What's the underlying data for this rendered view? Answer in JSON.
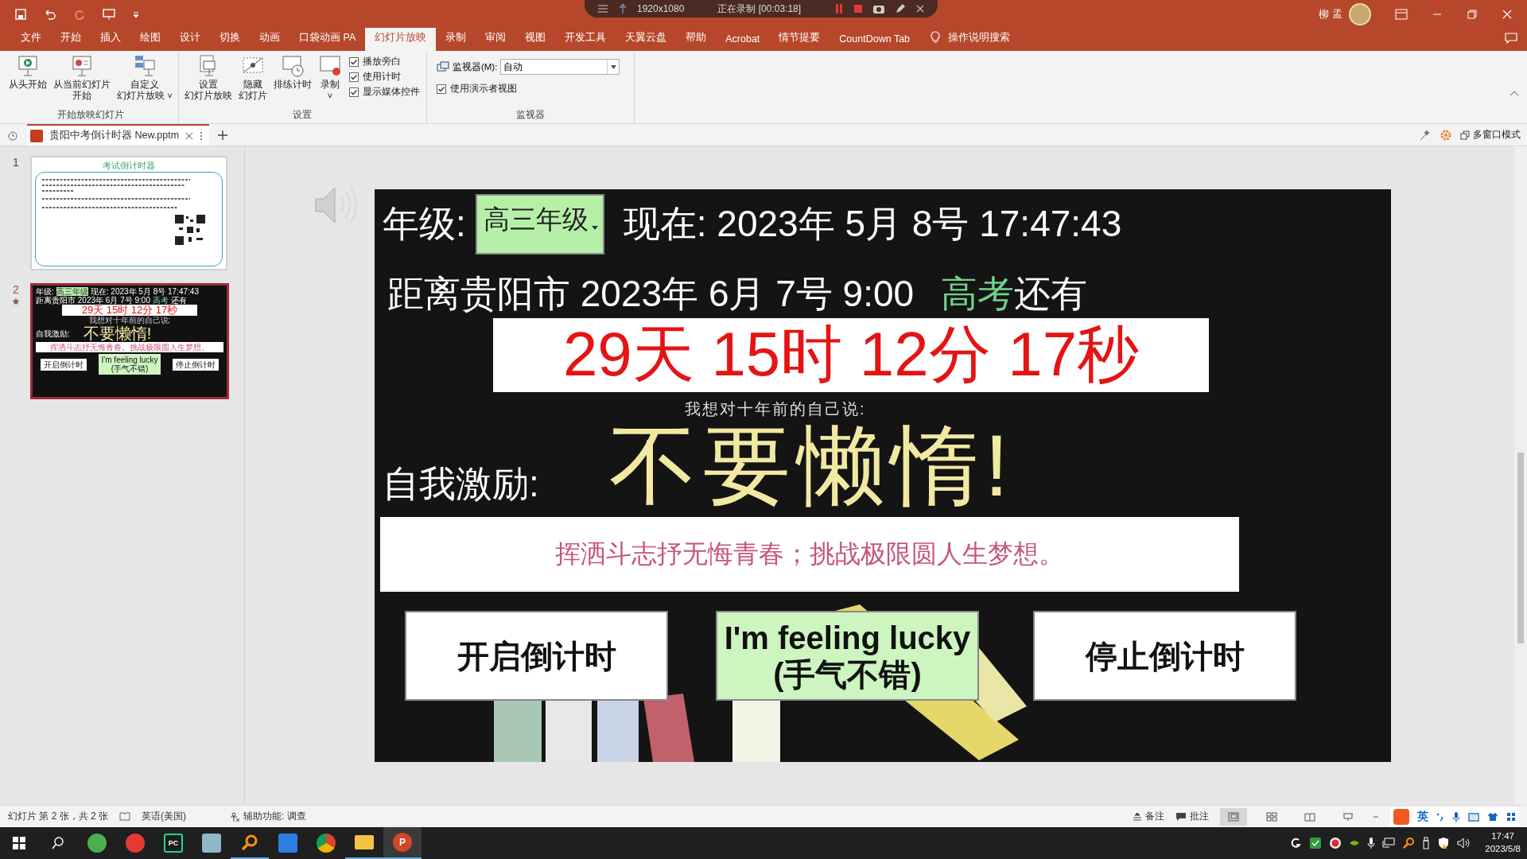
{
  "title_bar": {
    "recorder": {
      "resolution": "1920x1080",
      "status": "正在录制 [00:03:18]"
    },
    "user": "柳 孟"
  },
  "menu_tabs": [
    {
      "label": "文件",
      "selected": false
    },
    {
      "label": "开始",
      "selected": false
    },
    {
      "label": "插入",
      "selected": false
    },
    {
      "label": "绘图",
      "selected": false
    },
    {
      "label": "设计",
      "selected": false
    },
    {
      "label": "切换",
      "selected": false
    },
    {
      "label": "动画",
      "selected": false
    },
    {
      "label": "口袋动画 PA",
      "selected": false
    },
    {
      "label": "幻灯片放映",
      "selected": true
    },
    {
      "label": "录制",
      "selected": false
    },
    {
      "label": "审阅",
      "selected": false
    },
    {
      "label": "视图",
      "selected": false
    },
    {
      "label": "开发工具",
      "selected": false
    },
    {
      "label": "天翼云盘",
      "selected": false
    },
    {
      "label": "帮助",
      "selected": false
    },
    {
      "label": "Acrobat",
      "selected": false
    },
    {
      "label": "情节提要",
      "selected": false
    },
    {
      "label": "CountDown Tab",
      "selected": false
    }
  ],
  "tell_me": "操作说明搜索",
  "ribbon": {
    "groups": [
      {
        "label": "开始放映幻灯片",
        "items": [
          {
            "kind": "button",
            "lines": [
              "从头开始"
            ]
          },
          {
            "kind": "button",
            "lines": [
              "从当前幻灯片",
              "开始"
            ]
          },
          {
            "kind": "button",
            "lines": [
              "自定义",
              "幻灯片放映 ˅"
            ]
          }
        ]
      },
      {
        "label": "设置",
        "items": [
          {
            "kind": "button",
            "lines": [
              "设置",
              "幻灯片放映"
            ]
          },
          {
            "kind": "button",
            "lines": [
              "隐藏",
              "幻灯片"
            ]
          },
          {
            "kind": "button",
            "lines": [
              "排练计时"
            ]
          },
          {
            "kind": "button",
            "lines": [
              "录制",
              "˅"
            ]
          },
          {
            "kind": "checks",
            "checks": [
              {
                "label": "播放旁白",
                "checked": true
              },
              {
                "label": "使用计时",
                "checked": true
              },
              {
                "label": "显示媒体控件",
                "checked": true
              }
            ]
          }
        ]
      },
      {
        "label": "监视器",
        "items": [
          {
            "kind": "monitor",
            "label": "监视器(M):",
            "value": "自动",
            "checks": [
              {
                "label": "使用演示者视图",
                "checked": true
              }
            ]
          }
        ]
      }
    ]
  },
  "doc_tab": {
    "name": "贵阳中考倒计时器 New.pptm"
  },
  "multi_window": "多窗口模式",
  "thumbnails": [
    {
      "number": "1",
      "selected": false,
      "kind": "info",
      "title": "考试倒计时器"
    },
    {
      "number": "2",
      "selected": true,
      "kind": "countdown",
      "grade_label": "年级:",
      "grade": "高三年级",
      "now": "现在: 2023年 5月 8号 17:47:43",
      "target": "距离贵阳市 2023年 6月 7号 9:00",
      "exam": "高考",
      "remaining": "还有",
      "countdown": "29天 15时 12分 17秒",
      "note": "我想对十年前的自己说:",
      "motivation_label": "自我激励:",
      "motivation": "不要懒惰!",
      "motto": "挥洒斗志抒无悔青春。挑战极限圆人生梦想。",
      "buttons": [
        {
          "lines": [
            "开启倒计时"
          ],
          "selected": false
        },
        {
          "lines": [
            "I'm feeling lucky",
            "(手气不错)"
          ],
          "selected": true
        },
        {
          "lines": [
            "停止倒计时"
          ],
          "selected": false
        }
      ]
    }
  ],
  "slide": {
    "grade_label": "年级:",
    "grade": "高三年级",
    "now": "现在: 2023年 5月 8号 17:47:43",
    "target": "距离贵阳市 2023年 6月 7号 9:00",
    "exam": "高考",
    "remaining": "还有",
    "countdown": "29天 15时 12分 17秒",
    "note": "我想对十年前的自己说:",
    "motivation_label": "自我激励:",
    "motivation": "不要懒惰!",
    "motto": "挥洒斗志抒无悔青春；挑战极限圆人生梦想。",
    "buttons": [
      {
        "lines": [
          "开启倒计时"
        ],
        "selected": false
      },
      {
        "lines": [
          "I'm feeling lucky",
          "(手气不错)"
        ],
        "selected": true
      },
      {
        "lines": [
          "停止倒计时"
        ],
        "selected": false
      }
    ]
  },
  "status_bar": {
    "slide_info": "幻灯片 第 2 张，共 2 张",
    "language": "英语(美国)",
    "accessibility": "辅助功能: 调查",
    "notes": "备注",
    "comments": "批注",
    "views": [
      {
        "kind": "normal",
        "selected": true
      },
      {
        "kind": "sorter",
        "selected": false
      },
      {
        "kind": "reading",
        "selected": false
      },
      {
        "kind": "show",
        "selected": false
      }
    ],
    "ime": "英"
  },
  "taskbar": {
    "apps": [
      {
        "kind": "browser360",
        "running": false,
        "selected": false
      },
      {
        "kind": "redapp",
        "running": false,
        "selected": false
      },
      {
        "kind": "pycharm",
        "glyph": "PC",
        "running": false,
        "selected": false
      },
      {
        "kind": "notes",
        "running": false,
        "selected": false
      },
      {
        "kind": "magnifier",
        "running": true,
        "selected": false
      },
      {
        "kind": "bird",
        "running": false,
        "selected": false
      },
      {
        "kind": "chrome",
        "running": false,
        "selected": false
      },
      {
        "kind": "folder",
        "running": true,
        "selected": false
      },
      {
        "kind": "powerpoint",
        "glyph": "P",
        "running": true,
        "selected": true
      }
    ],
    "time": "17:47",
    "date": "2023/5/8"
  }
}
